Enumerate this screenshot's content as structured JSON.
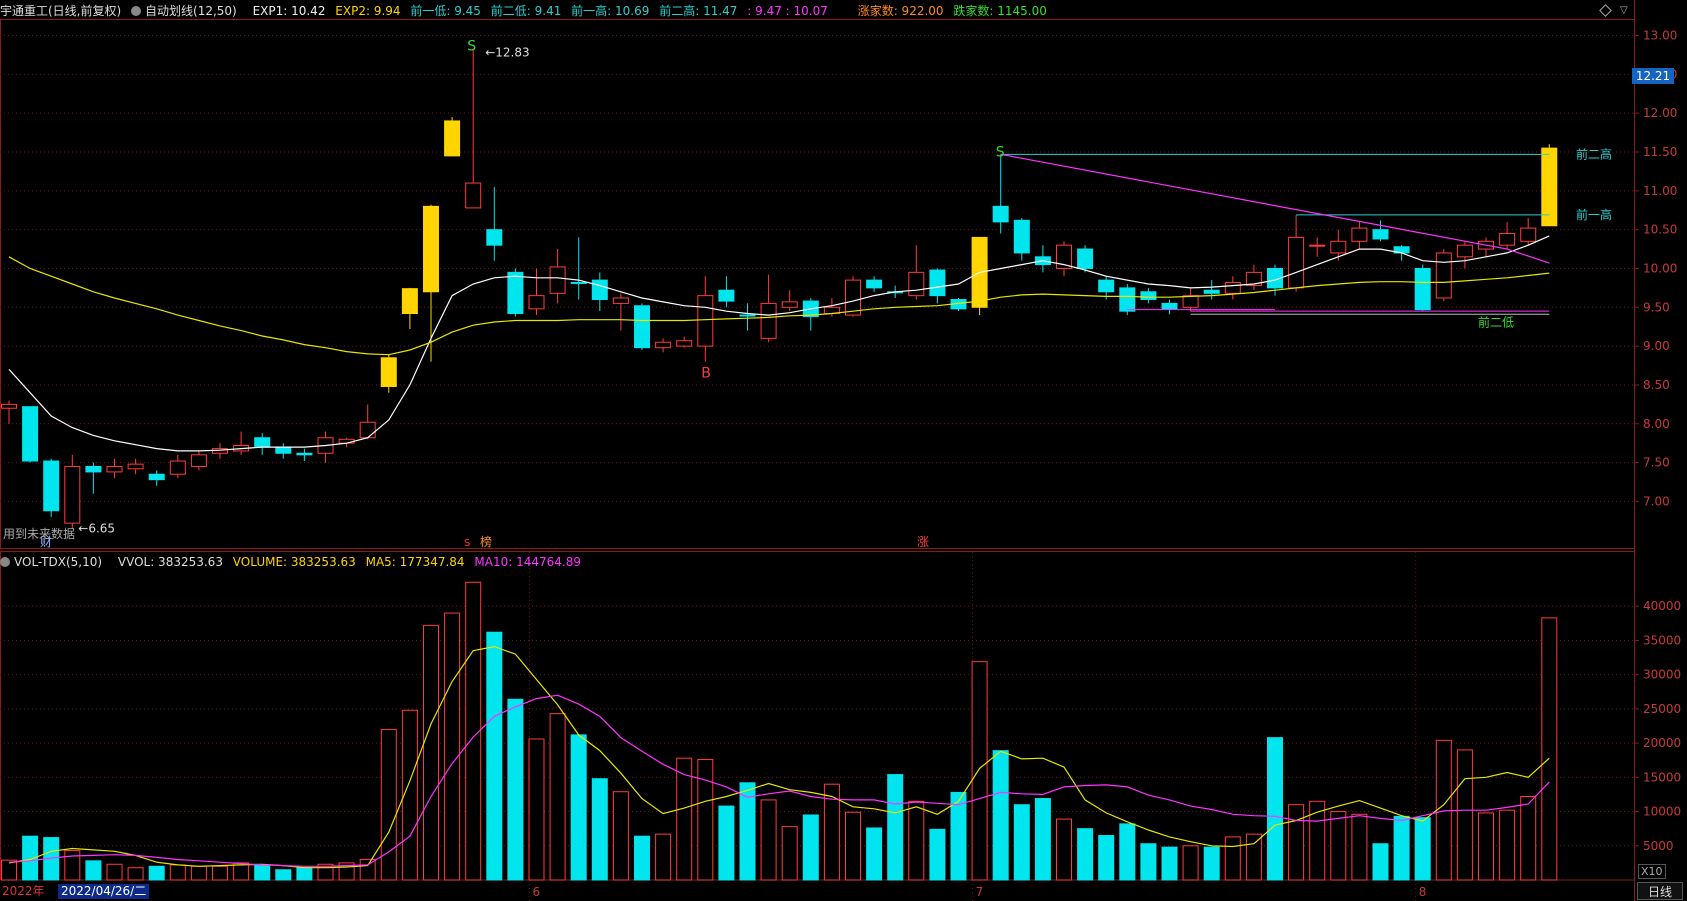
{
  "header": {
    "stock": "宇通重工(日线,前复权)",
    "indicator": "自动划线(12,50)",
    "exp1": "EXP1: 10.42",
    "exp2": "EXP2: 9.94",
    "low1": "前一低: 9.45",
    "low2": "前二低: 9.41",
    "high1": "前一高: 10.69",
    "high2": "前二高: 11.47",
    "range": ": 9.47 : 10.07",
    "up_count": "涨家数: 922.00",
    "down_count": "跌家数: 1145.00"
  },
  "vol_header": {
    "name": "VOL-TDX(5,10)",
    "vvol": "VVOL: 383253.63",
    "volume": "VOLUME: 383253.63",
    "ma5": "MA5: 177347.84",
    "ma10": "MA10: 144764.89"
  },
  "labels": {
    "current_price": "12.21",
    "future_note": "用到未来数据",
    "date": "2022/04/26/二",
    "year": "2022年",
    "period": "日线",
    "scale": "X10",
    "high_peak": "12.83",
    "low_trough": "6.65",
    "prev_high2": "前二高",
    "prev_high1": "前一高",
    "prev_low2": "前二低",
    "marker_s": "S",
    "marker_b": "B",
    "marker_cai": "财",
    "marker_bang": "榜",
    "marker_zhang": "涨",
    "marker_red": "S"
  },
  "colors": {
    "up": "#ff3b3b",
    "down": "#00e5ee",
    "limit": "#ffd400",
    "ma_white": "#ffffff",
    "ma_yellow": "#e6e600",
    "magenta": "#ff33ff",
    "cyan_line": "#2ad0d0"
  },
  "chart_data": {
    "type": "candlestick",
    "price_axis": {
      "ylim": [
        6.4,
        13.2
      ],
      "ticks": [
        7.0,
        7.5,
        8.0,
        8.5,
        9.0,
        9.5,
        10.0,
        10.5,
        11.0,
        11.5,
        12.0,
        12.5,
        13.0
      ]
    },
    "volume_axis": {
      "ylim": [
        0,
        45000
      ],
      "ticks": [
        5000,
        10000,
        15000,
        20000,
        25000,
        30000,
        35000,
        40000
      ],
      "unit_note": "X10"
    },
    "x_ticks": [
      {
        "index": 0,
        "label": "2022年"
      },
      {
        "index": 25,
        "label": "6"
      },
      {
        "index": 46,
        "label": "7"
      },
      {
        "index": 67,
        "label": "8"
      }
    ],
    "candles": [
      {
        "o": 8.2,
        "c": 8.25,
        "h": 8.3,
        "l": 8.0,
        "u": 1
      },
      {
        "o": 8.22,
        "c": 7.52,
        "h": 8.22,
        "l": 7.5,
        "u": 0
      },
      {
        "o": 7.52,
        "c": 6.88,
        "h": 7.55,
        "l": 6.8,
        "u": 0
      },
      {
        "o": 6.72,
        "c": 7.45,
        "h": 7.6,
        "l": 6.65,
        "u": 1
      },
      {
        "o": 7.45,
        "c": 7.38,
        "h": 7.5,
        "l": 7.1,
        "u": 0
      },
      {
        "o": 7.38,
        "c": 7.45,
        "h": 7.55,
        "l": 7.3,
        "u": 1
      },
      {
        "o": 7.42,
        "c": 7.48,
        "h": 7.55,
        "l": 7.35,
        "u": 1
      },
      {
        "o": 7.35,
        "c": 7.28,
        "h": 7.4,
        "l": 7.2,
        "u": 0
      },
      {
        "o": 7.35,
        "c": 7.52,
        "h": 7.6,
        "l": 7.3,
        "u": 1
      },
      {
        "o": 7.45,
        "c": 7.6,
        "h": 7.65,
        "l": 7.4,
        "u": 1
      },
      {
        "o": 7.62,
        "c": 7.68,
        "h": 7.75,
        "l": 7.55,
        "u": 1
      },
      {
        "o": 7.65,
        "c": 7.72,
        "h": 7.9,
        "l": 7.6,
        "u": 1
      },
      {
        "o": 7.82,
        "c": 7.7,
        "h": 7.88,
        "l": 7.6,
        "u": 0
      },
      {
        "o": 7.7,
        "c": 7.62,
        "h": 7.75,
        "l": 7.55,
        "u": 0
      },
      {
        "o": 7.62,
        "c": 7.6,
        "h": 7.68,
        "l": 7.52,
        "u": 0
      },
      {
        "o": 7.62,
        "c": 7.82,
        "h": 7.9,
        "l": 7.5,
        "u": 1
      },
      {
        "o": 7.75,
        "c": 7.8,
        "h": 7.82,
        "l": 7.7,
        "u": 1
      },
      {
        "o": 7.82,
        "c": 8.02,
        "h": 8.25,
        "l": 7.8,
        "u": 1
      },
      {
        "o": 8.48,
        "c": 8.85,
        "h": 8.9,
        "l": 8.4,
        "u": 1,
        "L": 1
      },
      {
        "o": 9.42,
        "c": 9.74,
        "h": 9.75,
        "l": 9.22,
        "u": 1,
        "L": 1
      },
      {
        "o": 9.7,
        "c": 10.8,
        "h": 10.82,
        "l": 8.8,
        "u": 1,
        "L": 1
      },
      {
        "o": 11.45,
        "c": 11.9,
        "h": 11.95,
        "l": 11.45,
        "u": 1,
        "L": 1
      },
      {
        "o": 10.78,
        "c": 11.1,
        "h": 12.83,
        "l": 10.78,
        "u": 1
      },
      {
        "o": 10.5,
        "c": 10.3,
        "h": 11.05,
        "l": 10.1,
        "u": 0
      },
      {
        "o": 9.95,
        "c": 9.42,
        "h": 10.0,
        "l": 9.38,
        "u": 0
      },
      {
        "o": 9.48,
        "c": 9.65,
        "h": 10.0,
        "l": 9.4,
        "u": 1
      },
      {
        "o": 9.68,
        "c": 10.02,
        "h": 10.25,
        "l": 9.55,
        "u": 1
      },
      {
        "o": 9.82,
        "c": 9.82,
        "h": 10.4,
        "l": 9.6,
        "u": 0
      },
      {
        "o": 9.85,
        "c": 9.6,
        "h": 9.95,
        "l": 9.45,
        "u": 0
      },
      {
        "o": 9.55,
        "c": 9.62,
        "h": 9.68,
        "l": 9.2,
        "u": 1
      },
      {
        "o": 9.52,
        "c": 8.98,
        "h": 9.55,
        "l": 8.95,
        "u": 0
      },
      {
        "o": 8.98,
        "c": 9.05,
        "h": 9.1,
        "l": 8.92,
        "u": 1
      },
      {
        "o": 9.0,
        "c": 9.07,
        "h": 9.12,
        "l": 8.98,
        "u": 1
      },
      {
        "o": 9.0,
        "c": 9.65,
        "h": 9.9,
        "l": 8.8,
        "u": 1
      },
      {
        "o": 9.72,
        "c": 9.58,
        "h": 9.9,
        "l": 9.5,
        "u": 0
      },
      {
        "o": 9.4,
        "c": 9.4,
        "h": 9.55,
        "l": 9.2,
        "u": 0
      },
      {
        "o": 9.1,
        "c": 9.55,
        "h": 9.92,
        "l": 9.05,
        "u": 1
      },
      {
        "o": 9.5,
        "c": 9.57,
        "h": 9.72,
        "l": 9.45,
        "u": 1
      },
      {
        "o": 9.58,
        "c": 9.38,
        "h": 9.62,
        "l": 9.2,
        "u": 0
      },
      {
        "o": 9.42,
        "c": 9.5,
        "h": 9.62,
        "l": 9.38,
        "u": 1
      },
      {
        "o": 9.4,
        "c": 9.85,
        "h": 9.9,
        "l": 9.38,
        "u": 1
      },
      {
        "o": 9.85,
        "c": 9.75,
        "h": 9.9,
        "l": 9.7,
        "u": 0
      },
      {
        "o": 9.7,
        "c": 9.7,
        "h": 9.78,
        "l": 9.62,
        "u": 0
      },
      {
        "o": 9.65,
        "c": 9.95,
        "h": 10.3,
        "l": 9.6,
        "u": 1
      },
      {
        "o": 9.98,
        "c": 9.65,
        "h": 10.0,
        "l": 9.55,
        "u": 0
      },
      {
        "o": 9.6,
        "c": 9.48,
        "h": 9.62,
        "l": 9.45,
        "u": 0
      },
      {
        "o": 9.5,
        "c": 10.4,
        "h": 10.4,
        "l": 9.4,
        "u": 1,
        "L": 1
      },
      {
        "o": 10.8,
        "c": 10.6,
        "h": 11.47,
        "l": 10.45,
        "u": 0
      },
      {
        "o": 10.62,
        "c": 10.2,
        "h": 10.65,
        "l": 10.1,
        "u": 0
      },
      {
        "o": 10.15,
        "c": 10.05,
        "h": 10.3,
        "l": 9.95,
        "u": 0
      },
      {
        "o": 10.0,
        "c": 10.3,
        "h": 10.35,
        "l": 9.9,
        "u": 1
      },
      {
        "o": 10.25,
        "c": 10.0,
        "h": 10.3,
        "l": 9.95,
        "u": 0
      },
      {
        "o": 9.85,
        "c": 9.7,
        "h": 9.9,
        "l": 9.6,
        "u": 0
      },
      {
        "o": 9.75,
        "c": 9.45,
        "h": 9.8,
        "l": 9.4,
        "u": 0
      },
      {
        "o": 9.7,
        "c": 9.6,
        "h": 9.75,
        "l": 9.55,
        "u": 0
      },
      {
        "o": 9.55,
        "c": 9.48,
        "h": 9.6,
        "l": 9.41,
        "u": 0
      },
      {
        "o": 9.5,
        "c": 9.65,
        "h": 9.75,
        "l": 9.45,
        "u": 1
      },
      {
        "o": 9.72,
        "c": 9.68,
        "h": 9.85,
        "l": 9.6,
        "u": 0
      },
      {
        "o": 9.68,
        "c": 9.82,
        "h": 9.9,
        "l": 9.6,
        "u": 1
      },
      {
        "o": 9.78,
        "c": 9.95,
        "h": 10.05,
        "l": 9.72,
        "u": 1
      },
      {
        "o": 10.0,
        "c": 9.75,
        "h": 10.05,
        "l": 9.65,
        "u": 0
      },
      {
        "o": 9.75,
        "c": 10.4,
        "h": 10.69,
        "l": 9.7,
        "u": 1
      },
      {
        "o": 10.3,
        "c": 10.3,
        "h": 10.4,
        "l": 10.15,
        "u": 1
      },
      {
        "o": 10.2,
        "c": 10.35,
        "h": 10.5,
        "l": 10.1,
        "u": 1
      },
      {
        "o": 10.35,
        "c": 10.52,
        "h": 10.6,
        "l": 10.25,
        "u": 1
      },
      {
        "o": 10.5,
        "c": 10.38,
        "h": 10.62,
        "l": 10.35,
        "u": 0
      },
      {
        "o": 10.28,
        "c": 10.2,
        "h": 10.3,
        "l": 10.1,
        "u": 0
      },
      {
        "o": 10.0,
        "c": 9.47,
        "h": 10.05,
        "l": 9.45,
        "u": 0
      },
      {
        "o": 9.62,
        "c": 10.2,
        "h": 10.25,
        "l": 9.58,
        "u": 1
      },
      {
        "o": 10.15,
        "c": 10.3,
        "h": 10.35,
        "l": 10.0,
        "u": 1
      },
      {
        "o": 10.25,
        "c": 10.35,
        "h": 10.4,
        "l": 10.15,
        "u": 1
      },
      {
        "o": 10.3,
        "c": 10.45,
        "h": 10.6,
        "l": 10.25,
        "u": 1
      },
      {
        "o": 10.35,
        "c": 10.52,
        "h": 10.65,
        "l": 10.3,
        "u": 1
      },
      {
        "o": 10.55,
        "c": 11.55,
        "h": 11.6,
        "l": 10.55,
        "u": 1,
        "L": 1
      }
    ],
    "volume": [
      2900,
      6400,
      6200,
      4300,
      2800,
      2300,
      1800,
      2000,
      2200,
      2000,
      2000,
      2500,
      2200,
      1500,
      1800,
      2300,
      2500,
      3000,
      22000,
      24800,
      37200,
      39000,
      43500,
      36200,
      26400,
      20600,
      24300,
      21200,
      14800,
      12900,
      6400,
      6700,
      17800,
      17600,
      10800,
      14200,
      11700,
      7800,
      9500,
      14000,
      9900,
      7600,
      15400,
      11500,
      7400,
      12800,
      31900,
      18900,
      11000,
      11900,
      8900,
      7500,
      6500,
      8200,
      5300,
      4800,
      5000,
      4800,
      6300,
      6700,
      20800,
      11000,
      11500,
      10000,
      9600,
      5300,
      9300,
      9100,
      20400,
      19000,
      9800,
      10200,
      12200,
      38300
    ],
    "ma_white": [
      8.7,
      8.4,
      8.1,
      7.95,
      7.85,
      7.78,
      7.73,
      7.68,
      7.65,
      7.65,
      7.66,
      7.68,
      7.7,
      7.7,
      7.7,
      7.72,
      7.75,
      7.82,
      8.05,
      8.5,
      9.1,
      9.65,
      9.8,
      9.88,
      9.9,
      9.88,
      9.88,
      9.85,
      9.78,
      9.7,
      9.62,
      9.57,
      9.52,
      9.5,
      9.45,
      9.42,
      9.4,
      9.43,
      9.48,
      9.52,
      9.58,
      9.65,
      9.7,
      9.72,
      9.76,
      9.8,
      9.95,
      10.0,
      10.05,
      10.1,
      10.05,
      9.98,
      9.9,
      9.85,
      9.8,
      9.78,
      9.75,
      9.76,
      9.78,
      9.8,
      9.85,
      9.95,
      10.05,
      10.15,
      10.25,
      10.25,
      10.2,
      10.1,
      10.08,
      10.1,
      10.15,
      10.2,
      10.3,
      10.42
    ],
    "ma_yellow": [
      10.15,
      10.0,
      9.9,
      9.8,
      9.7,
      9.62,
      9.55,
      9.48,
      9.4,
      9.33,
      9.26,
      9.2,
      9.13,
      9.08,
      9.02,
      8.98,
      8.93,
      8.9,
      8.89,
      8.95,
      9.05,
      9.18,
      9.27,
      9.31,
      9.33,
      9.33,
      9.33,
      9.34,
      9.34,
      9.34,
      9.33,
      9.33,
      9.33,
      9.34,
      9.35,
      9.36,
      9.37,
      9.39,
      9.4,
      9.42,
      9.45,
      9.48,
      9.5,
      9.51,
      9.52,
      9.55,
      9.58,
      9.63,
      9.66,
      9.67,
      9.66,
      9.65,
      9.64,
      9.64,
      9.63,
      9.63,
      9.64,
      9.65,
      9.67,
      9.69,
      9.72,
      9.75,
      9.78,
      9.8,
      9.82,
      9.83,
      9.83,
      9.82,
      9.82,
      9.84,
      9.86,
      9.88,
      9.91,
      9.94
    ],
    "vol_ma5": [
      2500,
      3000,
      4200,
      4600,
      4400,
      4200,
      3600,
      2600,
      2200,
      2000,
      2100,
      2200,
      2300,
      2100,
      1800,
      1800,
      1900,
      2100,
      7000,
      14500,
      22800,
      29000,
      33500,
      34100,
      33000,
      29300,
      25600,
      21200,
      18900,
      15600,
      11900,
      9700,
      10500,
      11500,
      12200,
      13100,
      14100,
      13200,
      12800,
      12200,
      10700,
      10400,
      9800,
      10700,
      9600,
      11500,
      16300,
      18800,
      17700,
      17800,
      16500,
      11700,
      9800,
      8500,
      7300,
      6300,
      5600,
      5000,
      4900,
      5300,
      8000,
      8700,
      9900,
      10800,
      11600,
      10500,
      9400,
      8600,
      11000,
      14800,
      15000,
      15700,
      15000,
      17800
    ],
    "vol_ma10": [
      2600,
      2800,
      3200,
      3500,
      3600,
      3700,
      3600,
      3300,
      3000,
      2800,
      2600,
      2400,
      2200,
      2100,
      2000,
      2000,
      2100,
      2200,
      4100,
      6400,
      12200,
      17000,
      20900,
      23900,
      25300,
      26500,
      27000,
      25700,
      23900,
      20800,
      18800,
      16900,
      15400,
      14600,
      13600,
      12100,
      12600,
      13000,
      12200,
      11800,
      11700,
      11700,
      11100,
      11400,
      11200,
      11000,
      11900,
      12800,
      12600,
      12500,
      13600,
      13800,
      13900,
      13600,
      12400,
      11700,
      10800,
      10300,
      9600,
      9400,
      9300,
      8700,
      8600,
      9000,
      9400,
      9000,
      8700,
      9400,
      10100,
      10200,
      10200,
      10600,
      11100,
      14300
    ]
  }
}
